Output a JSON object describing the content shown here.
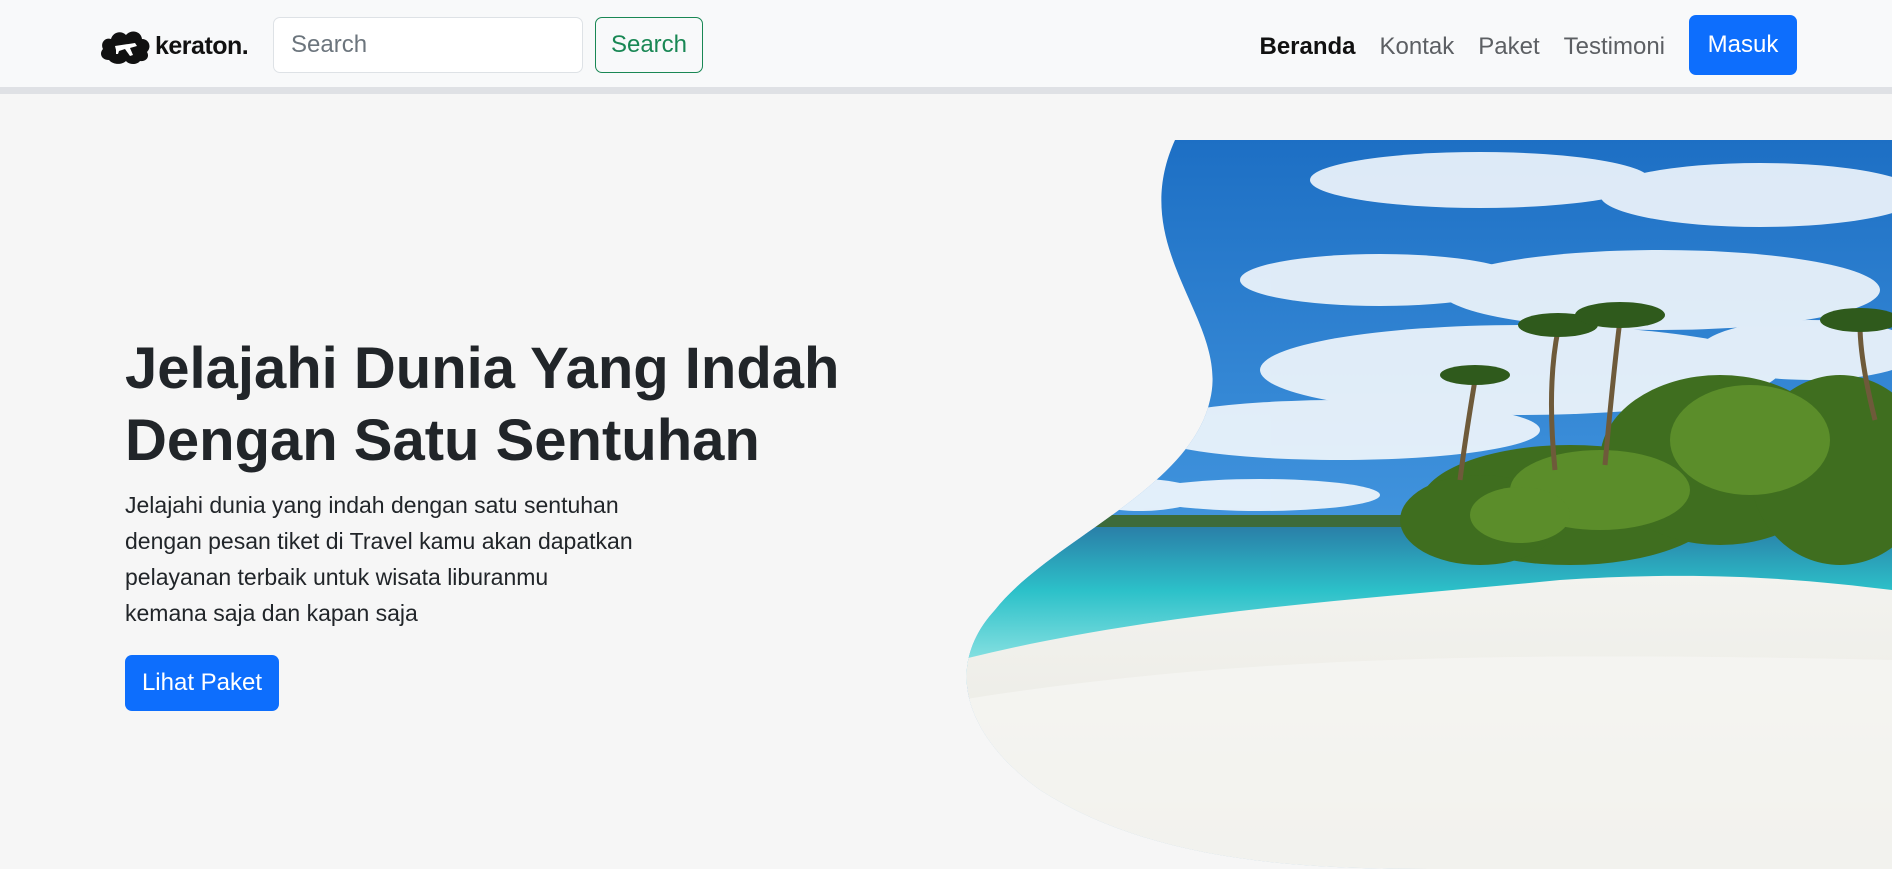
{
  "navbar": {
    "brand_name": "keraton.",
    "logo_icon": "cloud-plane-logo",
    "search_placeholder": "Search",
    "search_button_label": "Search",
    "links": [
      {
        "label": "Beranda",
        "active": true
      },
      {
        "label": "Kontak",
        "active": false
      },
      {
        "label": "Paket",
        "active": false
      },
      {
        "label": "Testimoni",
        "active": false
      }
    ],
    "login_label": "Masuk"
  },
  "hero": {
    "title_line1": "Jelajahi Dunia Yang Indah",
    "title_line2": "Dengan Satu Sentuhan",
    "description": [
      "Jelajahi dunia yang indah dengan satu sentuhan",
      "dengan pesan tiket di Travel kamu akan dapatkan",
      "pelayanan terbaik untuk wisata liburanmu",
      "kemana saja dan kapan saja"
    ],
    "cta_label": "Lihat Paket",
    "image_subject": "tropical-beach-photo"
  },
  "colors": {
    "primary": "#0d6efd",
    "success": "#198754",
    "page_background": "#f6f6f6",
    "navbar_background": "#f8f9fa"
  }
}
